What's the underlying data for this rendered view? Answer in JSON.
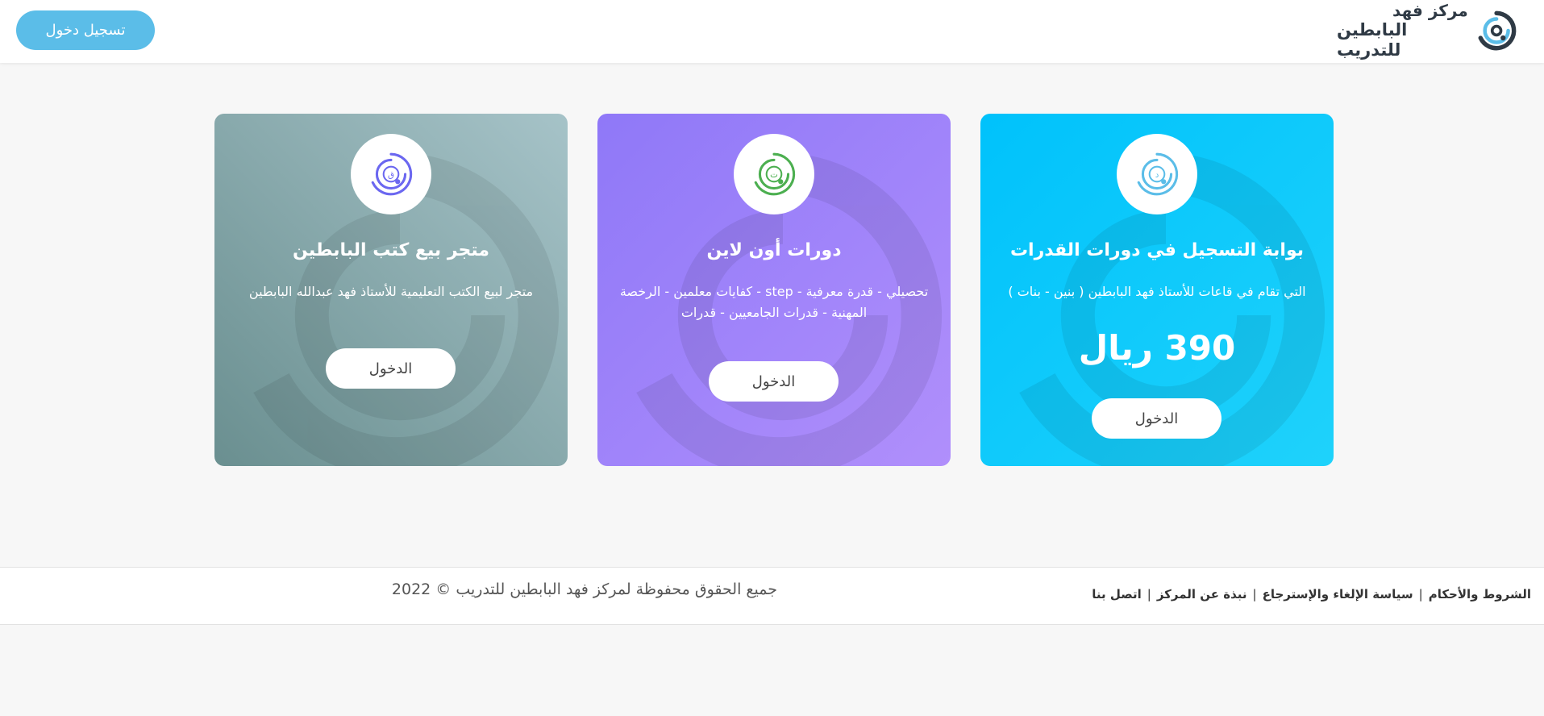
{
  "header": {
    "login_button": "تسجيل دخول",
    "logo": {
      "line1": "مركز فهد",
      "line2": "البابطين للتدريب",
      "icon": "fahd-center-logo-icon"
    }
  },
  "cards": [
    {
      "title": "بوابة التسجيل في دورات القدرات",
      "description": "التي تقام في قاعات للأستاذ فهد البابطين ( بنين - بنات )",
      "price": "390 ريال",
      "button": "الدخول",
      "icon": "capabilities-logo-icon",
      "icon_color": "#5bbde8",
      "background": "#00c2fb"
    },
    {
      "title": "دورات أون لاين",
      "description": "تحصيلي - قدرة معرفية - step - كفايات معلمين - الرخصة المهنية - قدرات الجامعيين - قدرات",
      "button": "الدخول",
      "icon": "online-courses-logo-icon",
      "icon_color": "#4caf50",
      "background": "#9a80f9"
    },
    {
      "title": "متجر بيع كتب البابطين",
      "description": "متجر لبيع الكتب التعليمية للأستاذ فهد عبدالله البابطين",
      "button": "الدخول",
      "icon": "bookstore-logo-icon",
      "icon_color": "#6b67f0",
      "background": "#86a6a8"
    }
  ],
  "footer": {
    "links": [
      "الشروط والأحكام",
      "سياسة الإلغاء والإسترجاع",
      "نبذة عن المركز",
      "اتصل بنا"
    ],
    "separator": "|",
    "copyright": "جميع الحقوق محفوظة لمركز فهد البابطين للتدريب © 2022"
  }
}
